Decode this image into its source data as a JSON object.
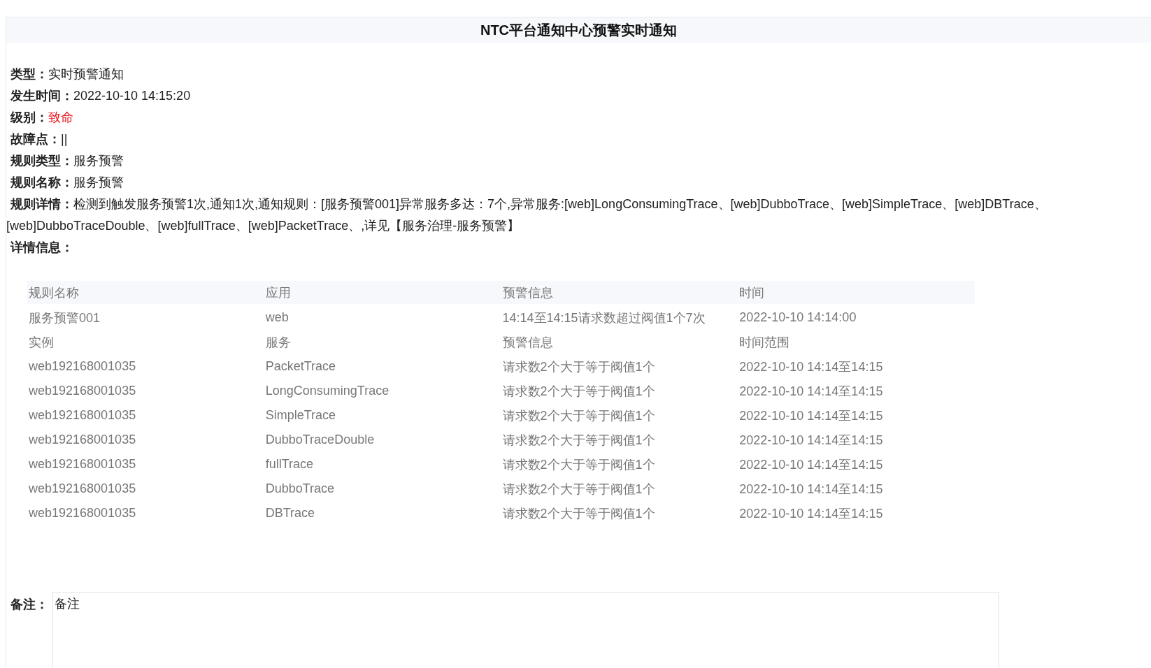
{
  "title": "NTC平台通知中心预警实时通知",
  "fields": [
    {
      "label": "类型：",
      "value": "实时预警通知",
      "kind": "plain"
    },
    {
      "label": "发生时间：",
      "value": "2022-10-10 14:15:20",
      "kind": "plain"
    },
    {
      "label": "级别：",
      "value": "致命",
      "kind": "severity"
    },
    {
      "label": "故障点：",
      "value": "||",
      "kind": "plain"
    },
    {
      "label": "规则类型：",
      "value": "服务预警",
      "kind": "plain"
    },
    {
      "label": "规则名称：",
      "value": "服务预警",
      "kind": "plain"
    },
    {
      "label": "规则详情：",
      "value": "检测到触发服务预警1次,通知1次,通知规则：[服务预警001]异常服务多达：7个,异常服务:[web]LongConsumingTrace、[web]DubboTrace、[web]SimpleTrace、[web]DBTrace、[web]DubboTraceDouble、[web]fullTrace、[web]PacketTrace、,详见【服务治理-服务预警】",
      "kind": "plain"
    },
    {
      "label": "详情信息："
    }
  ],
  "table": {
    "columns": [
      "规则名称",
      "应用",
      "预警信息",
      "时间"
    ],
    "rows": [
      [
        "服务预警001",
        "web",
        "14:14至14:15请求数超过阀值1个7次",
        "2022-10-10 14:14:00"
      ],
      [
        "实例",
        "服务",
        "预警信息",
        "时间范围"
      ],
      [
        "web192168001035",
        "PacketTrace",
        "请求数2个大于等于阀值1个",
        "2022-10-10 14:14至14:15"
      ],
      [
        "web192168001035",
        "LongConsumingTrace",
        "请求数2个大于等于阀值1个",
        "2022-10-10 14:14至14:15"
      ],
      [
        "web192168001035",
        "SimpleTrace",
        "请求数2个大于等于阀值1个",
        "2022-10-10 14:14至14:15"
      ],
      [
        "web192168001035",
        "DubboTraceDouble",
        "请求数2个大于等于阀值1个",
        "2022-10-10 14:14至14:15"
      ],
      [
        "web192168001035",
        "fullTrace",
        "请求数2个大于等于阀值1个",
        "2022-10-10 14:14至14:15"
      ],
      [
        "web192168001035",
        "DubboTrace",
        "请求数2个大于等于阀值1个",
        "2022-10-10 14:14至14:15"
      ],
      [
        "web192168001035",
        "DBTrace",
        "请求数2个大于等于阀值1个",
        "2022-10-10 14:14至14:15"
      ]
    ]
  },
  "remarks": {
    "label": "备注：",
    "value": "备注"
  }
}
